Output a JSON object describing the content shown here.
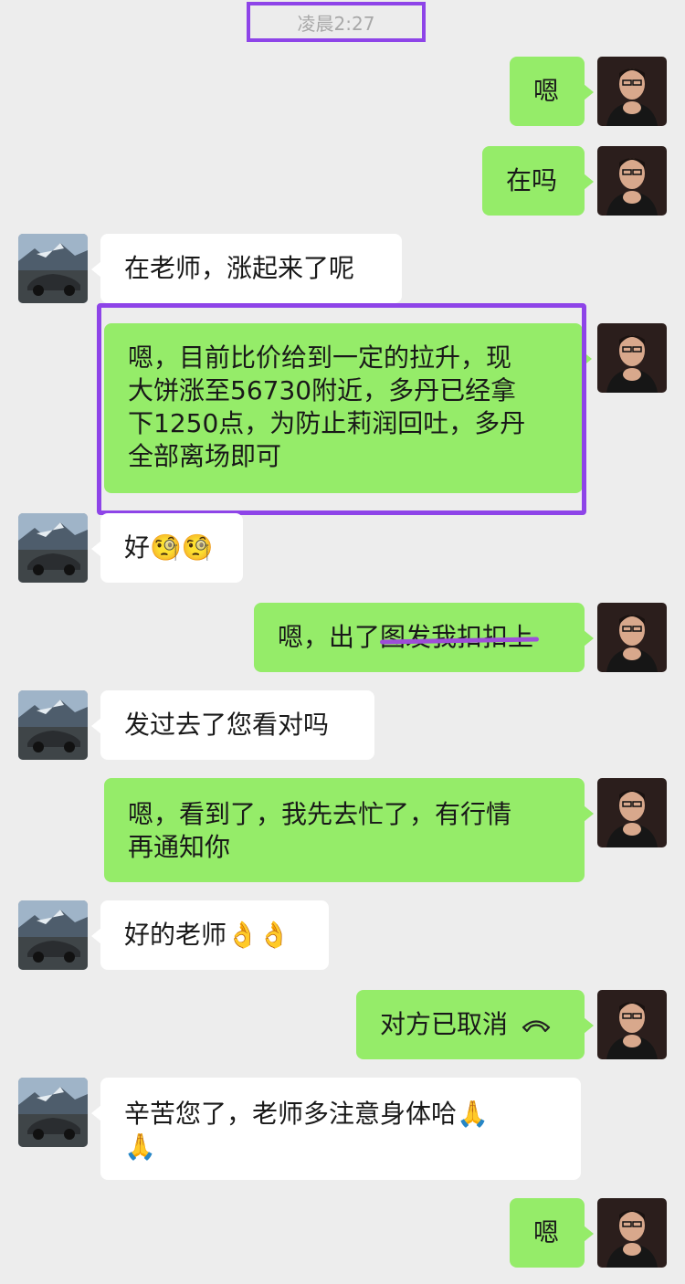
{
  "timestamp": "凌晨2:27",
  "messages": [
    {
      "from": "me",
      "text": "嗯"
    },
    {
      "from": "me",
      "text": "在吗"
    },
    {
      "from": "other",
      "text": "在老师，涨起来了呢"
    },
    {
      "from": "me",
      "lines": [
        "嗯，目前比价给到一定的拉升，现",
        "大饼涨至56730附近，多丹已经拿",
        "下1250点，为防止莉润回吐，多丹",
        "全部离场即可"
      ]
    },
    {
      "from": "other",
      "text": "好",
      "emoji": "🧐🧐"
    },
    {
      "from": "me",
      "text": "嗯，出了",
      "struck_text": "图发我扣扣上"
    },
    {
      "from": "other",
      "text": "发过去了您看对吗"
    },
    {
      "from": "me",
      "lines": [
        "嗯，看到了，我先去忙了，有行情",
        "再通知你"
      ]
    },
    {
      "from": "other",
      "text": "好的老师",
      "emoji": "👌👌"
    },
    {
      "from": "me",
      "text": "对方已取消",
      "icon": "phone-hangup-icon"
    },
    {
      "from": "other",
      "line1": "辛苦您了，老师多注意身体哈",
      "emoji1": "🙏",
      "emoji2": "🙏"
    },
    {
      "from": "me",
      "text": "嗯"
    }
  ],
  "colors": {
    "my_bubble": "#95ec69",
    "their_bubble": "#ffffff",
    "background": "#ededed",
    "highlight": "#8e44e8"
  }
}
